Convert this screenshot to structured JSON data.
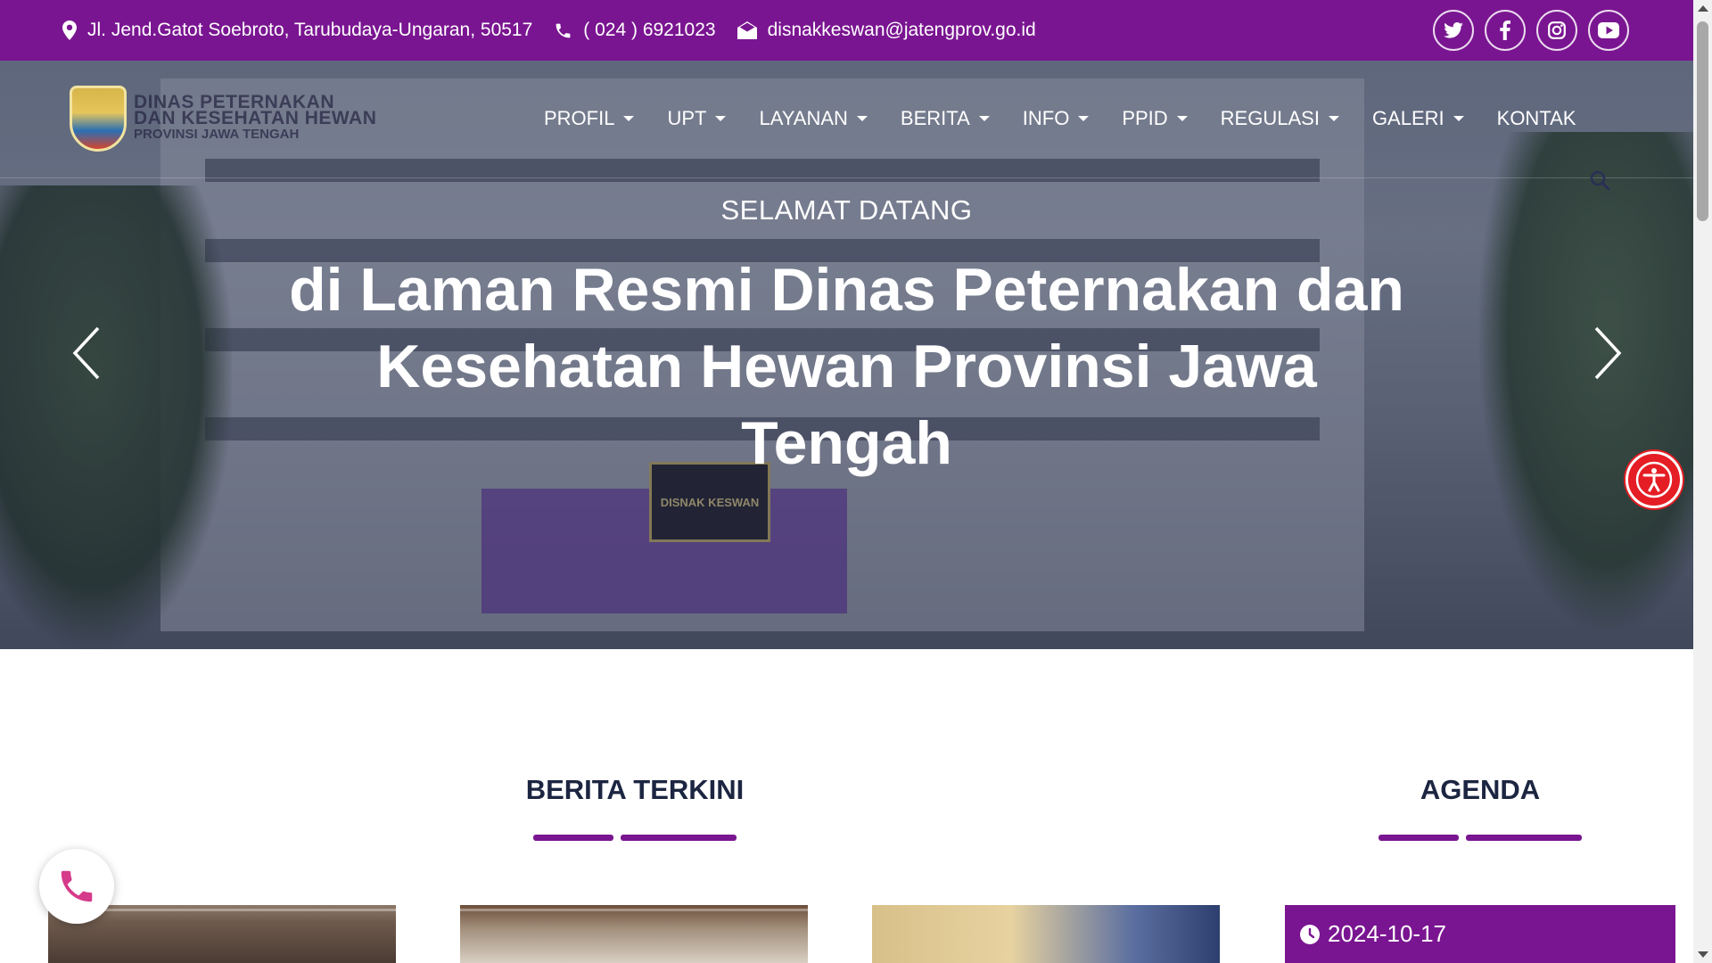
{
  "topbar": {
    "address": "Jl. Jend.Gatot Soebroto, Tarubudaya-Ungaran, 50517",
    "phone": "( 024 ) 6921023",
    "email": "disnakkeswan@jatengprov.go.id",
    "social": [
      "twitter-icon",
      "facebook-icon",
      "instagram-icon",
      "youtube-icon"
    ],
    "bg_color": "#7a1591"
  },
  "logo": {
    "line1": "DINAS PETERNAKAN",
    "line2": "DAN KESEHATAN HEWAN",
    "line3": "PROVINSI JAWA TENGAH"
  },
  "nav": {
    "items": [
      {
        "label": "PROFIL",
        "dropdown": true
      },
      {
        "label": "UPT",
        "dropdown": true
      },
      {
        "label": "LAYANAN",
        "dropdown": true
      },
      {
        "label": "BERITA",
        "dropdown": true
      },
      {
        "label": "INFO",
        "dropdown": true
      },
      {
        "label": "PPID",
        "dropdown": true
      },
      {
        "label": "REGULASI",
        "dropdown": true
      },
      {
        "label": "GALERI",
        "dropdown": true
      },
      {
        "label": "KONTAK",
        "dropdown": false
      }
    ]
  },
  "hero": {
    "subtitle": "SELAMAT DATANG",
    "title": "di Laman Resmi Dinas Peternakan dan Kesehatan Hewan Provinsi Jawa Tengah",
    "sign_text": "DISNAK KESWAN"
  },
  "sections": {
    "news_title": "BERITA TERKINI",
    "agenda_title": "AGENDA"
  },
  "agenda": {
    "first_date": "2024-10-17"
  },
  "colors": {
    "accent": "#7a1591",
    "accessibility": "#e51d24",
    "heading": "#1c2541"
  }
}
